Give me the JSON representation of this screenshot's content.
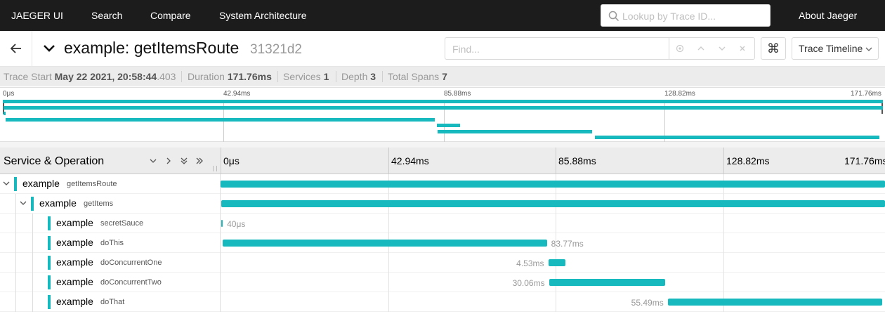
{
  "nav": {
    "brand": "JAEGER UI",
    "links": [
      "Search",
      "Compare",
      "System Architecture"
    ],
    "search_placeholder": "Lookup by Trace ID...",
    "about": "About Jaeger"
  },
  "trace": {
    "name": "example: getItemsRoute",
    "id": "31321d2",
    "find_placeholder": "Find...",
    "cmd_glyph": "⌘",
    "view": "Trace Timeline"
  },
  "summary": {
    "trace_start_label": "Trace Start",
    "trace_start_date": "May 22 2021, 20:58:44",
    "trace_start_ms": ".403",
    "duration_label": "Duration",
    "duration": "171.76ms",
    "services_label": "Services",
    "services": "1",
    "depth_label": "Depth",
    "depth": "3",
    "spans_label": "Total Spans",
    "spans": "7"
  },
  "ticks": [
    "0μs",
    "42.94ms",
    "85.88ms",
    "128.82ms",
    "171.76ms"
  ],
  "columns": {
    "service_operation": "Service & Operation"
  },
  "spans": [
    {
      "service": "example",
      "operation": "getItemsRoute",
      "depth": 0,
      "start_ms": 0.0,
      "duration_ms": 171.76,
      "duration_label": ""
    },
    {
      "service": "example",
      "operation": "getItems",
      "depth": 1,
      "start_ms": 0.1,
      "duration_ms": 171.6,
      "duration_label": ""
    },
    {
      "service": "example",
      "operation": "secretSauce",
      "depth": 2,
      "start_ms": 0.2,
      "duration_ms": 0.04,
      "duration_label": "40μs"
    },
    {
      "service": "example",
      "operation": "doThis",
      "depth": 2,
      "start_ms": 0.6,
      "duration_ms": 83.77,
      "duration_label": "83.77ms"
    },
    {
      "service": "example",
      "operation": "doConcurrentOne",
      "depth": 2,
      "start_ms": 84.7,
      "duration_ms": 4.53,
      "duration_label": "4.53ms"
    },
    {
      "service": "example",
      "operation": "doConcurrentTwo",
      "depth": 2,
      "start_ms": 84.9,
      "duration_ms": 30.06,
      "duration_label": "30.06ms"
    },
    {
      "service": "example",
      "operation": "doThat",
      "depth": 2,
      "start_ms": 115.6,
      "duration_ms": 55.49,
      "duration_label": "55.49ms"
    }
  ],
  "colors": {
    "span": "#17b8be",
    "nav_bg": "#1c1c1c"
  }
}
